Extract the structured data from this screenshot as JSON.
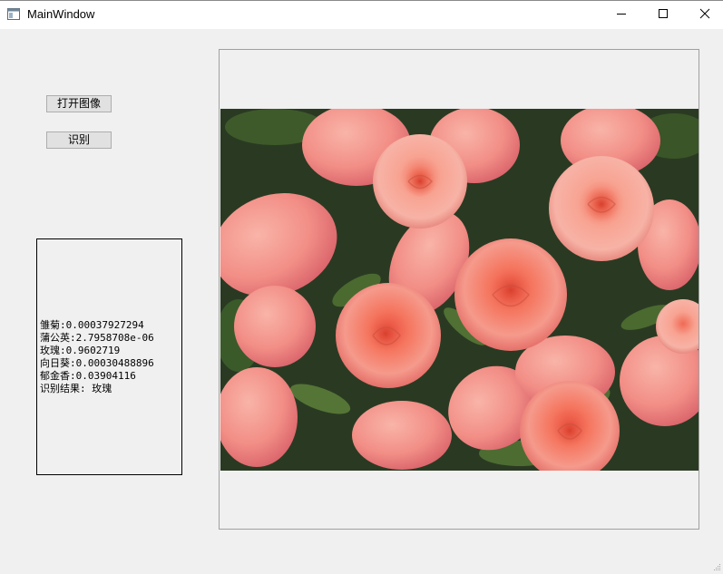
{
  "window": {
    "title": "MainWindow",
    "icons": {
      "app": "app-window-icon",
      "minimize": "minimize-icon",
      "maximize": "maximize-icon",
      "close": "close-icon"
    }
  },
  "controls": {
    "open_image_label": "打开图像",
    "recognize_label": "识别"
  },
  "results": {
    "lines": [
      "雏菊:0.00037927294",
      "蒲公英:2.7958708e-06",
      "玫瑰:0.9602719",
      "向日葵:0.00030488896",
      "郁金香:0.03904116",
      "识别结果: 玫瑰"
    ]
  },
  "image": {
    "subject": "pink-roses-photo"
  }
}
